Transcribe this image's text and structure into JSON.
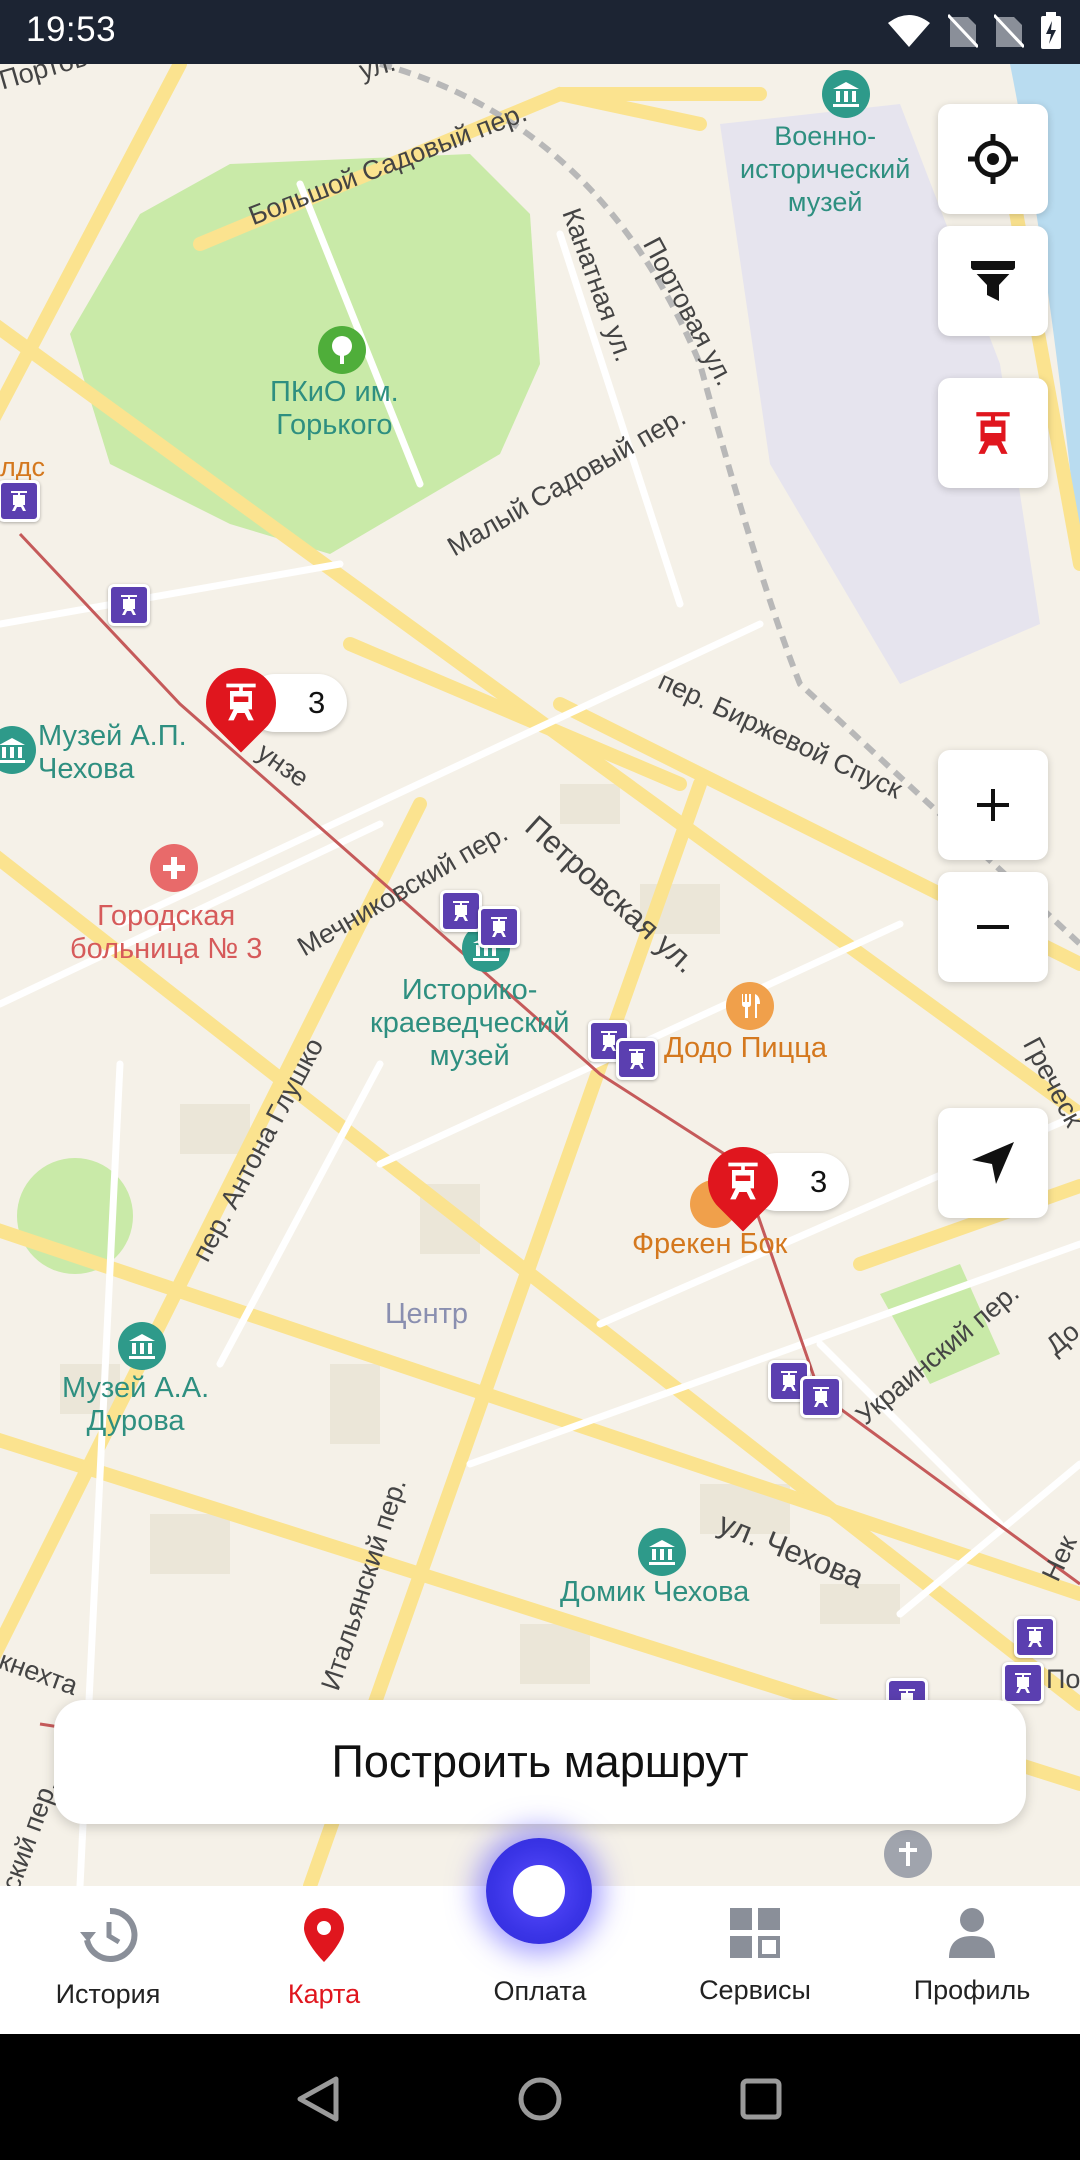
{
  "status_bar": {
    "time": "19:53"
  },
  "map": {
    "streets": [
      "Портова",
      "ул.",
      "Большой Садовый пер.",
      "Канатная ул.",
      "Портовая ул.",
      "Малый Садовый пер.",
      "пер. Биржевой Спуск",
      "Петровская ул.",
      "Мечниковский пер.",
      "унзе",
      "пер. Антона Глушко",
      "Греческ",
      "Украинский пер.",
      "ул. Чехова",
      "Итальянский пер.",
      "кнехта",
      "ский пер.",
      "лдс",
      "Нек",
      "Пол",
      "До"
    ],
    "district": "Центр",
    "pois": {
      "military_museum": "Военно-\nисторический\nмузей",
      "park": "ПКиО им.\nГорького",
      "chekhov_museum": "Музей А.П.\nЧехова",
      "hospital": "Городская\nбольница № 3",
      "local_history_museum": "Историко-\nкраеведческий\nмузей",
      "dodo": "Додо Пицца",
      "freken": "Фрекен Бок",
      "durov_museum": "Музей А.А.\nДурова",
      "chekhov_house": "Домик Чехова"
    },
    "vehicles": [
      {
        "count": "3"
      },
      {
        "count": "3"
      }
    ]
  },
  "controls": {
    "icons": [
      "crosshair-icon",
      "filter-icon",
      "tram-icon",
      "zoom-in-icon",
      "zoom-out-icon",
      "navigation-arrow-icon"
    ]
  },
  "route_button": {
    "label": "Построить маршрут"
  },
  "bottom_nav": {
    "items": [
      {
        "label": "История",
        "icon": "history-icon"
      },
      {
        "label": "Карта",
        "icon": "map-pin-icon"
      },
      {
        "label": "Оплата",
        "icon": "pay-icon"
      },
      {
        "label": "Сервисы",
        "icon": "services-icon"
      },
      {
        "label": "Профиль",
        "icon": "profile-icon"
      }
    ],
    "active": "Карта"
  },
  "colors": {
    "accent_red": "#e0161e",
    "tram_stop": "#5b3fb0",
    "pay_button": "#3a34e6",
    "status_bar": "#1c2433"
  }
}
